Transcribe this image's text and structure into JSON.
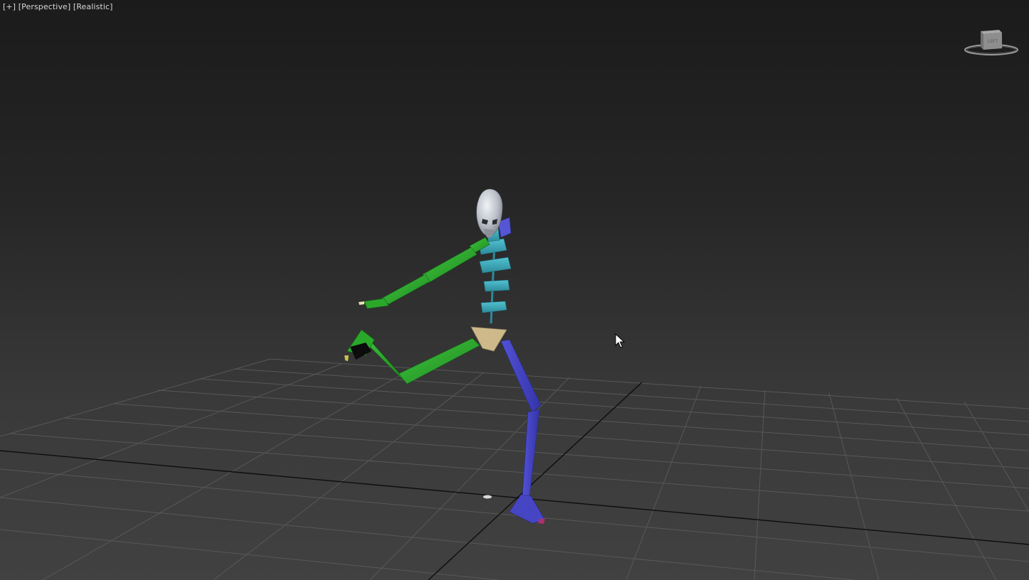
{
  "viewport": {
    "label_plus": "[+]",
    "label_view": "[Perspective]",
    "label_shading": "[Realistic]"
  },
  "viewcube": {
    "face_label": "LEFT",
    "icon": "viewcube-icon"
  },
  "scene": {
    "object": "biped-skeleton",
    "colors": {
      "left_limbs": "#2ea82e",
      "right_limbs": "#4a4acc",
      "spine": "#3aa6b8",
      "pelvis": "#c8b47c",
      "head": "#c8ccd4",
      "grid": "#5c5c5c",
      "grid_axis": "#0a0a0a"
    }
  }
}
